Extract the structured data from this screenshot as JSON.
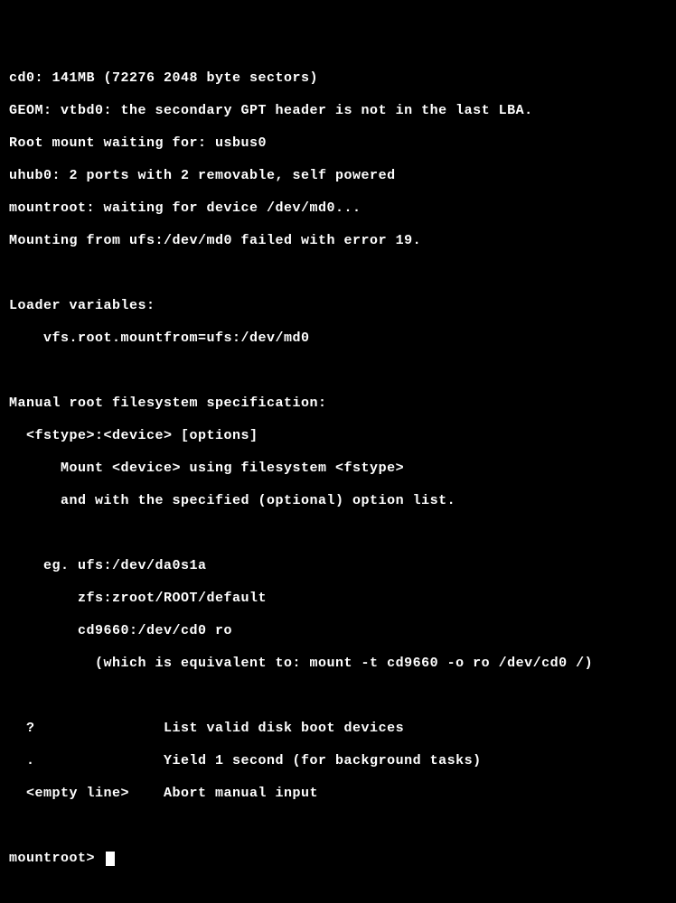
{
  "boot": {
    "l1": "cd0: 141MB (72276 2048 byte sectors)",
    "l2": "GEOM: vtbd0: the secondary GPT header is not in the last LBA.",
    "l3": "Root mount waiting for: usbus0",
    "l4": "uhub0: 2 ports with 2 removable, self powered",
    "l5": "mountroot: waiting for device /dev/md0...",
    "l6": "Mounting from ufs:/dev/md0 failed with error 19."
  },
  "loader": {
    "header": "Loader variables:",
    "var1": "    vfs.root.mountfrom=ufs:/dev/md0"
  },
  "manual": {
    "header": "Manual root filesystem specification:",
    "syntax": "  <fstype>:<device> [options]",
    "desc1": "      Mount <device> using filesystem <fstype>",
    "desc2": "      and with the specified (optional) option list."
  },
  "examples": {
    "eg1": "    eg. ufs:/dev/da0s1a",
    "eg2": "        zfs:zroot/ROOT/default",
    "eg3": "        cd9660:/dev/cd0 ro",
    "eg4": "          (which is equivalent to: mount -t cd9660 -o ro /dev/cd0 /)"
  },
  "commands": {
    "c1": "  ?               List valid disk boot devices",
    "c2": "  .               Yield 1 second (for background tasks)",
    "c3": "  <empty line>    Abort manual input"
  },
  "prompt": {
    "text": "mountroot> "
  }
}
